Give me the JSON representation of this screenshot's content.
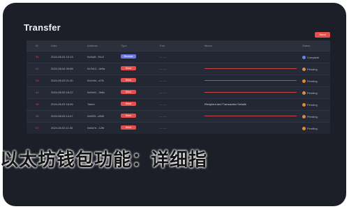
{
  "window": {
    "title": "Transfer"
  },
  "toolbar": {
    "action_label": "Send"
  },
  "table": {
    "headers": [
      "ID",
      "Date",
      "Address",
      "Type",
      "Fee",
      "Memo",
      "Status"
    ],
    "rows": [
      {
        "id": "01",
        "date": "2024-08-04 10:13",
        "address": "0x3a4f...91c2",
        "badge": "Receive",
        "dash": "— —",
        "note": "",
        "status": "Complete",
        "status_color": "#5a87e8",
        "badge_color": "#6c7be8"
      },
      {
        "id": "02",
        "date": "2024-08-04 09:58",
        "address": "0x7b12...4e9a",
        "badge": "Send",
        "dash": "— —",
        "note": "bar",
        "status": "Pending",
        "status_color": "#e38b2c",
        "badge_color": "#e5504a"
      },
      {
        "id": "03",
        "date": "2024-08-03 21:40",
        "address": "0x2c9d...a7f1",
        "badge": "Send",
        "dash": "— —",
        "note": "bar",
        "status": "Pending",
        "status_color": "#e38b2c",
        "badge_color": "#e5504a"
      },
      {
        "id": "04",
        "date": "2024-08-03 18:22",
        "address": "0x9e01...3b6c",
        "badge": "Send",
        "dash": "— —",
        "note": "bar",
        "status": "Pending",
        "status_color": "#e38b2c",
        "badge_color": "#e5504a"
      },
      {
        "id": "05",
        "date": "2024-08-03 16:05",
        "address": "Token",
        "badge": "Send",
        "dash": "— —",
        "note": "Recipient and Transaction Details",
        "status": "Pending",
        "status_color": "#e38b2c",
        "badge_color": "#e5504a"
      },
      {
        "id": "06",
        "date": "2024-08-03 14:47",
        "address": "0x5f33...c8d0",
        "badge": "Send",
        "dash": "— —",
        "note": "bar",
        "status": "Pending",
        "status_color": "#e38b2c",
        "badge_color": "#e5504a"
      },
      {
        "id": "07",
        "date": "2024-08-03 11:30",
        "address": "0x8a7e...12fb",
        "badge": "Send",
        "dash": "— —",
        "note": "",
        "status": "Pending",
        "status_color": "#e38b2c",
        "badge_color": "#e5504a"
      }
    ]
  },
  "banner": {
    "text": "以太坊钱包功能：详细指"
  }
}
